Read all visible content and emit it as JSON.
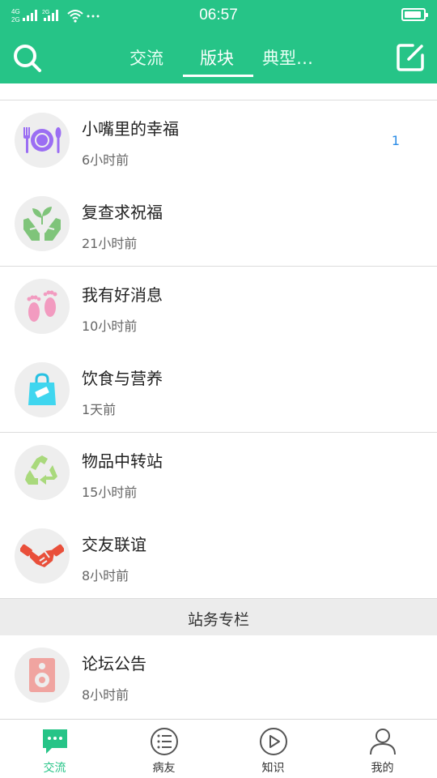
{
  "status_bar": {
    "time": "06:57",
    "network_left": "4G",
    "network_right": "2G"
  },
  "header": {
    "tabs": [
      {
        "label": "交流",
        "active": false
      },
      {
        "label": "版块",
        "active": true
      },
      {
        "label": "典型…",
        "active": false
      }
    ],
    "accent_color": "#26c487"
  },
  "forums": [
    {
      "title": "小嘴里的幸福",
      "time": "6小时前",
      "count": "1",
      "icon": "plate-fork-spoon-icon"
    },
    {
      "title": "复查求祝福",
      "time": "21小时前",
      "count": "",
      "icon": "hands-sprout-icon"
    },
    {
      "title": "我有好消息",
      "time": "10小时前",
      "count": "",
      "icon": "baby-feet-icon"
    },
    {
      "title": "饮食与营养",
      "time": "1天前",
      "count": "",
      "icon": "shopping-bag-icon"
    },
    {
      "title": "物品中转站",
      "time": "15小时前",
      "count": "",
      "icon": "recycle-icon"
    },
    {
      "title": "交友联谊",
      "time": "8小时前",
      "count": "",
      "icon": "handshake-icon"
    }
  ],
  "section": {
    "title": "站务专栏"
  },
  "station_forums": [
    {
      "title": "论坛公告",
      "time": "8小时前",
      "icon": "speaker-icon"
    }
  ],
  "bottom_nav": [
    {
      "label": "交流",
      "icon": "chat-bubble-icon",
      "active": true
    },
    {
      "label": "病友",
      "icon": "list-icon",
      "active": false
    },
    {
      "label": "知识",
      "icon": "play-icon",
      "active": false
    },
    {
      "label": "我的",
      "icon": "person-icon",
      "active": false
    }
  ]
}
